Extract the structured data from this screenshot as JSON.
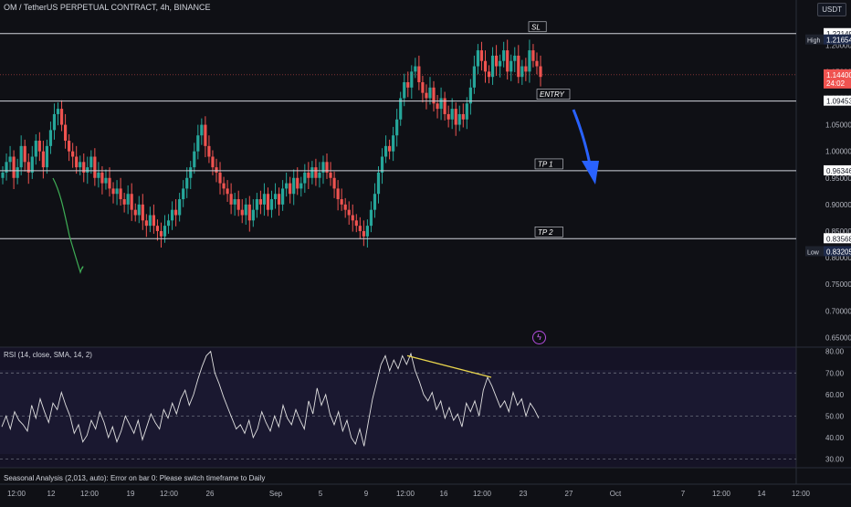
{
  "header": {
    "title": "OM / TetherUS PERPETUAL CONTRACT, 4h, BINANCE",
    "currency": "USDT"
  },
  "chart_data": [
    {
      "type": "candlestick",
      "title": "OM / TetherUS PERPETUAL CONTRACT, 4h, BINANCE",
      "ylim": [
        0.63,
        1.24
      ],
      "y_ticks": [
        "1.20000",
        "1.15000",
        "1.10000",
        "1.05000",
        "1.00000",
        "0.95000",
        "0.90000",
        "0.85000",
        "0.80000",
        "0.75000",
        "0.70000",
        "0.65000"
      ],
      "x_ticks": [
        "12:00",
        "12",
        "12:00",
        "19",
        "12:00",
        "26",
        "Sep",
        "5",
        "9",
        "12:00",
        "16",
        "12:00",
        "23",
        "27",
        "Oct",
        "7",
        "12:00",
        "14",
        "12:00"
      ],
      "price_labels": {
        "top": "1.22149",
        "high_tag": "High",
        "high": "1.21654",
        "current": "1.14400",
        "countdown": "24:02",
        "entry": "1.09453",
        "tp1": "0.96346",
        "tp2": "0.83568",
        "low_tag": "Low",
        "low": "0.83205"
      },
      "levels": [
        {
          "name": "SL",
          "value": 1.22149
        },
        {
          "name": "ENTRY",
          "value": 1.09453
        },
        {
          "name": "TP 1",
          "value": 0.96346
        },
        {
          "name": "TP 2",
          "value": 0.83568
        }
      ],
      "series_close": [
        0.96,
        0.98,
        0.99,
        0.95,
        0.97,
        1.01,
        0.98,
        0.96,
        0.99,
        1.02,
        1.0,
        0.97,
        1.01,
        1.04,
        1.07,
        1.08,
        1.05,
        1.02,
        1.0,
        0.99,
        0.97,
        0.98,
        0.96,
        0.97,
        0.99,
        0.95,
        0.96,
        0.94,
        0.95,
        0.93,
        0.92,
        0.93,
        0.91,
        0.9,
        0.92,
        0.89,
        0.88,
        0.9,
        0.87,
        0.86,
        0.88,
        0.86,
        0.85,
        0.84,
        0.86,
        0.87,
        0.89,
        0.88,
        0.91,
        0.93,
        0.95,
        0.97,
        1.0,
        1.03,
        1.05,
        1.01,
        0.99,
        0.97,
        0.96,
        0.94,
        0.93,
        0.92,
        0.9,
        0.91,
        0.89,
        0.88,
        0.9,
        0.87,
        0.89,
        0.91,
        0.9,
        0.92,
        0.89,
        0.91,
        0.92,
        0.9,
        0.93,
        0.94,
        0.92,
        0.95,
        0.93,
        0.94,
        0.96,
        0.95,
        0.97,
        0.95,
        0.96,
        0.98,
        0.96,
        0.95,
        0.93,
        0.91,
        0.9,
        0.89,
        0.88,
        0.87,
        0.86,
        0.85,
        0.84,
        0.86,
        0.89,
        0.92,
        0.96,
        0.99,
        1.01,
        1.0,
        1.03,
        1.06,
        1.1,
        1.13,
        1.12,
        1.15,
        1.16,
        1.13,
        1.11,
        1.1,
        1.12,
        1.09,
        1.08,
        1.1,
        1.07,
        1.06,
        1.08,
        1.05,
        1.07,
        1.06,
        1.09,
        1.12,
        1.16,
        1.19,
        1.17,
        1.15,
        1.14,
        1.18,
        1.16,
        1.17,
        1.19,
        1.15,
        1.17,
        1.18,
        1.14,
        1.16,
        1.15,
        1.19,
        1.17,
        1.16,
        1.14
      ]
    },
    {
      "type": "line",
      "title": "RSI (14, close, SMA, 14, 2)",
      "ylim": [
        26,
        82
      ],
      "y_ticks": [
        "80.00",
        "70.00",
        "60.00",
        "50.00",
        "40.00",
        "30.00"
      ],
      "bands": [
        70,
        50,
        30
      ],
      "values": [
        45,
        50,
        44,
        52,
        48,
        46,
        43,
        55,
        49,
        58,
        52,
        47,
        56,
        53,
        61,
        55,
        50,
        42,
        46,
        38,
        41,
        48,
        44,
        52,
        47,
        40,
        45,
        38,
        43,
        50,
        46,
        42,
        48,
        39,
        45,
        51,
        47,
        44,
        53,
        49,
        56,
        51,
        58,
        62,
        55,
        60,
        67,
        73,
        78,
        80,
        70,
        65,
        59,
        54,
        49,
        44,
        46,
        42,
        48,
        40,
        44,
        52,
        47,
        43,
        50,
        45,
        55,
        49,
        46,
        53,
        48,
        44,
        57,
        51,
        63,
        55,
        60,
        51,
        46,
        52,
        43,
        48,
        40,
        37,
        44,
        36,
        47,
        58,
        66,
        74,
        78,
        71,
        76,
        72,
        78,
        74,
        79,
        71,
        66,
        60,
        57,
        61,
        53,
        57,
        49,
        54,
        48,
        51,
        45,
        56,
        52,
        57,
        50,
        62,
        68,
        64,
        59,
        54,
        57,
        52,
        61,
        55,
        58,
        50,
        56,
        53,
        49
      ],
      "annotations": [
        {
          "type": "trendline",
          "from": 78,
          "to": 68
        }
      ]
    }
  ],
  "indicator": {
    "rsi_label": "RSI (14, close, SMA, 14, 2)",
    "seasonal_label": "Seasonal Analysis (2,013, auto): Error on bar 0: Please switch timeframe to Daily"
  },
  "colors": {
    "up": "#26a69a",
    "down": "#ef5350",
    "arrow": "#2962ff",
    "rsi_line": "#e0e0e0",
    "trendline": "#e8d44d",
    "background": "#0f1015"
  }
}
